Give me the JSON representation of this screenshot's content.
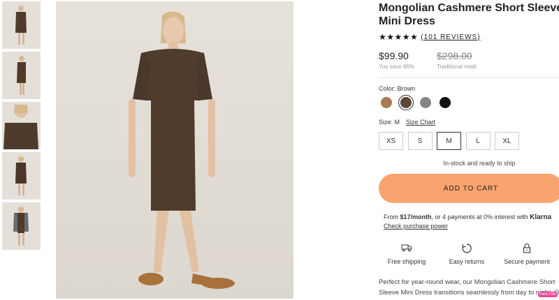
{
  "product": {
    "title": "Mongolian Cashmere Short Sleeve Mini Dress",
    "stars": "★★★★★",
    "reviews_label": "(101 REVIEWS)",
    "price": "$99.90",
    "savings": "You save 66%",
    "old_price": "$298.00",
    "old_price_label": "Traditional retail"
  },
  "color": {
    "label": "Color: Brown",
    "swatches": [
      {
        "name": "Camel",
        "hex": "#a97b52"
      },
      {
        "name": "Brown",
        "hex": "#5e4738",
        "selected": true
      },
      {
        "name": "Grey",
        "hex": "#858585"
      },
      {
        "name": "Black",
        "hex": "#111111"
      }
    ]
  },
  "size": {
    "label": "Size: M",
    "guide": "Size Chart",
    "options": [
      "XS",
      "S",
      "M",
      "L",
      "XL"
    ],
    "selected": "M"
  },
  "stock_text": "In-stock and ready to ship",
  "cart_label": "ADD TO CART",
  "klarna": {
    "prefix": "From ",
    "amount": "$17/month",
    "suffix": ", or 4 payments at 0% interest with ",
    "logo": "Klarna",
    "link": "Check purchase power"
  },
  "perks": [
    {
      "label": "Free shipping",
      "icon": "truck-icon"
    },
    {
      "label": "Easy returns",
      "icon": "return-icon"
    },
    {
      "label": "Secure payment",
      "icon": "lock-icon"
    }
  ],
  "description": "Perfect for year-round wear, our Mongolian Cashmere Short Sleeve Mini Dress transitions seamlessly from day to night. Our quality cashmere is incredibly long-lasting and three times as warm as wool.",
  "badge": "Paint 3 Me"
}
